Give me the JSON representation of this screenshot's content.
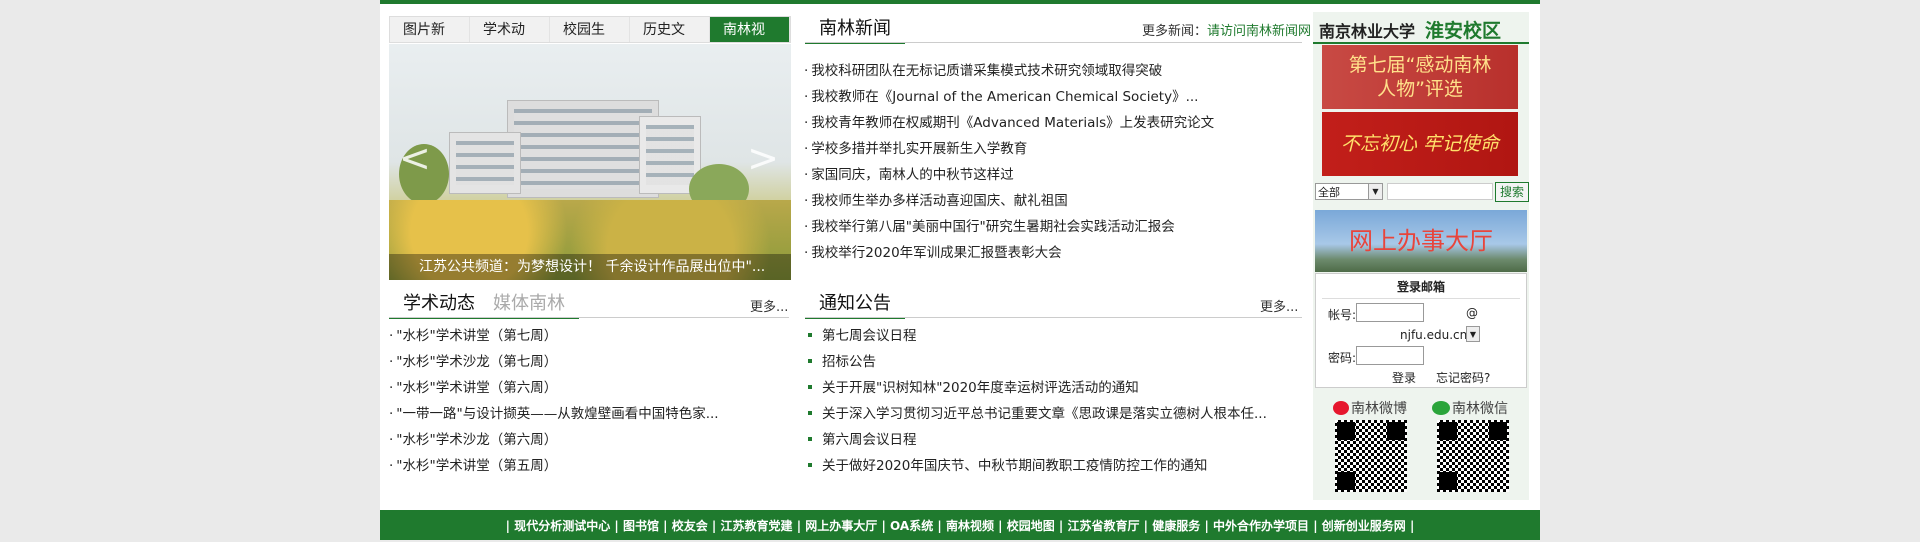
{
  "tabs": [
    "图片新闻",
    "学术动态",
    "校园生活",
    "历史文化",
    "南林视频"
  ],
  "slide_caption": "江苏公共频道：为梦想设计！ 千余设计作品展出位中\"...",
  "news": {
    "title": "南林新闻",
    "more_label": "更多新闻：",
    "more_link": "请访问南林新闻网",
    "items": [
      "我校科研团队在无标记质谱采集模式技术研究领域取得突破",
      "我校教师在《Journal of the American Chemical Society》...",
      "我校青年教师在权威期刊《Advanced Materials》上发表研究论文",
      "学校多措并举扎实开展新生入学教育",
      "家国同庆，南林人的中秋节这样过",
      "我校师生举办多样活动喜迎国庆、献礼祖国",
      "我校举行第八届\"美丽中国行\"研究生暑期社会实践活动汇报会",
      "我校举行2020年军训成果汇报暨表彰大会"
    ]
  },
  "academic": {
    "title": "学术动态",
    "alt_title": "媒体南林",
    "more": "更多...",
    "items": [
      "\"水杉\"学术讲堂（第七周）",
      "\"水杉\"学术沙龙（第七周）",
      "\"水杉\"学术讲堂（第六周）",
      "\"一带一路\"与设计撷英——从敦煌壁画看中国特色家...",
      "\"水杉\"学术沙龙（第六周）",
      "\"水杉\"学术讲堂（第五周）"
    ]
  },
  "notices": {
    "title": "通知公告",
    "more": "更多...",
    "items": [
      "第七周会议日程",
      "招标公告",
      "关于开展\"识树知林\"2020年度幸运树评选活动的通知",
      "关于深入学习贯彻习近平总书记重要文章《思政课是落实立德树人根本任...",
      "第六周会议日程",
      "关于做好2020年国庆节、中秋节期间教职工疫情防控工作的通知"
    ]
  },
  "right": {
    "school": "南京林业大学",
    "campus": "淮安校区",
    "banner1_line1": "第七届“感动南林",
    "banner1_line2": "人物”评选",
    "banner2": "不忘初心 牢记使命",
    "search_scope": "全部",
    "search_btn": "搜索",
    "hall": "网上办事大厅",
    "mail_title": "登录邮箱",
    "account_label": "帐号:",
    "at": "@",
    "domain": "njfu.edu.cn",
    "password_label": "密码:",
    "login_btn": "登录",
    "forgot": "忘记密码?",
    "weibo": "南林微博",
    "wechat": "南林微信"
  },
  "footer": [
    "现代分析测试中心",
    "图书馆",
    "校友会",
    "江苏教育党建",
    "网上办事大厅",
    "OA系统",
    "南林视频",
    "校园地图",
    "江苏省教育厅",
    "健康服务",
    "中外合作办学项目",
    "创新创业服务网"
  ],
  "colors": {
    "brand_green": "#1f7a2e"
  }
}
